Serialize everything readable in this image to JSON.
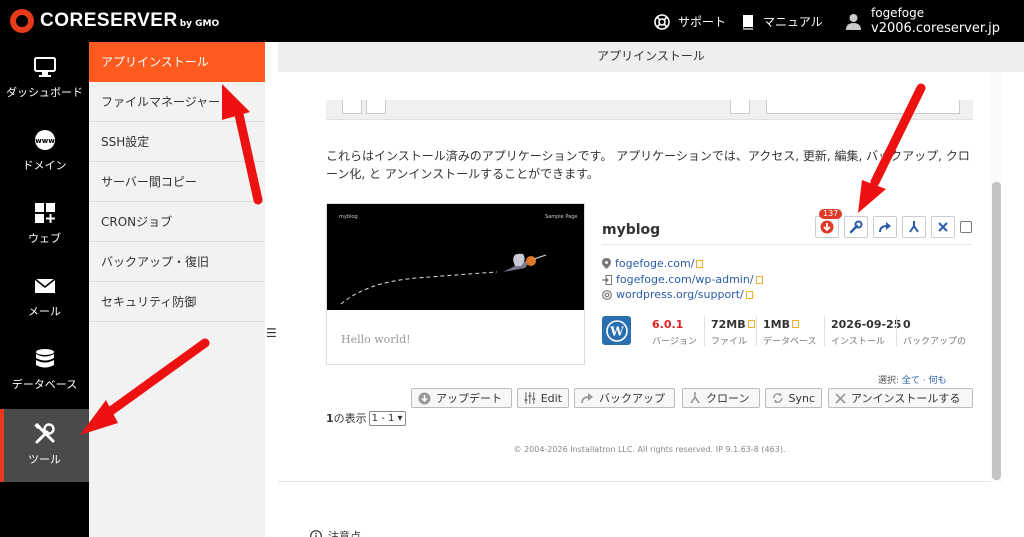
{
  "header": {
    "brand": "CORESERVER",
    "brand_sub": "by GMO",
    "support": "サポート",
    "manual": "マニュアル",
    "user_name": "fogefoge",
    "user_host": "v2006.coreserver.jp"
  },
  "leftnav": {
    "items": [
      {
        "label": "ダッシュボード",
        "icon": "monitor-icon"
      },
      {
        "label": "ドメイン",
        "icon": "www-globe-icon"
      },
      {
        "label": "ウェブ",
        "icon": "grid-plus-icon"
      },
      {
        "label": "メール",
        "icon": "envelope-icon"
      },
      {
        "label": "データベース",
        "icon": "database-icon"
      },
      {
        "label": "ツール",
        "icon": "tools-icon"
      }
    ],
    "active": "ツール"
  },
  "subnav": {
    "items": [
      {
        "label": "アプリインストール"
      },
      {
        "label": "ファイルマネージャー"
      },
      {
        "label": "SSH設定"
      },
      {
        "label": "サーバー間コピー"
      },
      {
        "label": "CRONジョブ"
      },
      {
        "label": "バックアップ・復旧"
      },
      {
        "label": "セキュリティ防御"
      }
    ],
    "active": "アプリインストール"
  },
  "main": {
    "page_title": "アプリインストール",
    "intro": "これらはインストール済みのアプリケーションです。 アプリケーションでは、アクセス, 更新, 編集, バックアップ, クローン化, と アンインストールすることができます。",
    "app": {
      "thumb_blog": "myblog",
      "thumb_sample": "Sample Page",
      "thumb_hello": "Hello world!",
      "name": "myblog",
      "update_badge": "137",
      "links": [
        "fogefoge.com/",
        "fogefoge.com/wp-admin/",
        "wordpress.org/support/"
      ],
      "stats": [
        {
          "value": "6.0.1",
          "label": "バージョン"
        },
        {
          "value": "72MB",
          "label": "ファイル"
        },
        {
          "value": "1MB",
          "label": "データベース"
        },
        {
          "value": "2026-09-25",
          "label": "インストール"
        },
        {
          "value": "0",
          "label": "バックアップの"
        }
      ]
    },
    "select": {
      "prefix": "選択:",
      "all": "全て",
      "none": "何も"
    },
    "bulk_buttons": [
      "アップデート",
      "Edit",
      "バックアップ",
      "クローン",
      "Sync",
      "アンインストールする"
    ],
    "pager": {
      "count": "1",
      "suffix": "の表示",
      "range": "1 - 1"
    },
    "footer": "© 2004-2026 Installatron LLC. All rights reserved. IP 9.1.63-8 (463).",
    "notes": "注意点"
  },
  "colors": {
    "accent": "#ff5b1f",
    "brand_red": "#e63a1c",
    "link": "#2b5ca8",
    "arrow": "#ee1111"
  }
}
